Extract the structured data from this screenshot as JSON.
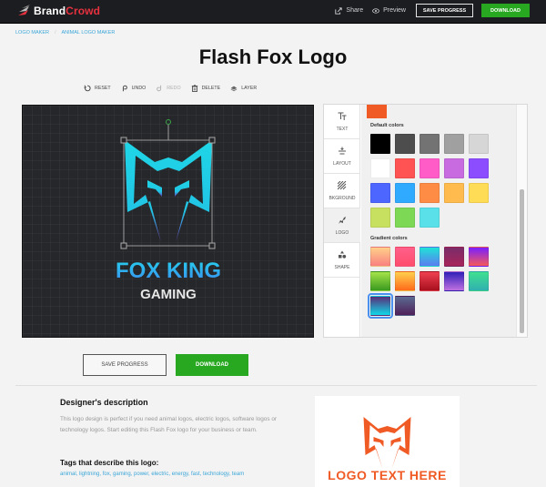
{
  "header": {
    "brand_part1": "Brand",
    "brand_part2": "Crowd",
    "share_label": "Share",
    "preview_label": "Preview",
    "save_progress_label": "SAVE PROGRESS",
    "download_label": "DOWNLOAD"
  },
  "breadcrumb": {
    "items": [
      "LOGO MAKER",
      "ANIMAL LOGO MAKER"
    ],
    "separator": "/"
  },
  "page_title": "Flash Fox Logo",
  "toolbar": {
    "reset": "RESET",
    "undo": "UNDO",
    "redo": "REDO",
    "delete": "DELETE",
    "layer": "LAYER"
  },
  "canvas": {
    "logo_title": "FOX KING",
    "logo_subtitle": "GAMING"
  },
  "editor_tabs": [
    {
      "label": "TEXT",
      "icon": "text-icon"
    },
    {
      "label": "LAYOUT",
      "icon": "layout-icon"
    },
    {
      "label": "BKGROUND",
      "icon": "background-icon"
    },
    {
      "label": "LOGO",
      "icon": "logo-icon",
      "active": true
    },
    {
      "label": "SHAPE",
      "icon": "shape-icon"
    }
  ],
  "color_panel": {
    "current_color": "#f05a24",
    "default_colors_label": "Default colors",
    "default_colors": [
      "#000000",
      "#4d4d4d",
      "#737373",
      "#a0a0a0",
      "#d6d6d6",
      "#ffffff",
      "#ff5252",
      "#ff5cc8",
      "#c86be0",
      "#8c4dff",
      "#4d66ff",
      "#30aaff",
      "#ff8c45",
      "#ffbb4d",
      "#ffdc55",
      "#c8e060",
      "#7dd855",
      "#5ae0e8"
    ],
    "gradient_colors_label": "Gradient colors",
    "gradient_colors": [
      [
        "#ffd08a",
        "#f98080"
      ],
      [
        "#ff5f8a",
        "#ff4d6d"
      ],
      [
        "#20e3d8",
        "#5b7cf0"
      ],
      [
        "#7a2d6a",
        "#a8245a"
      ],
      [
        "#7b1fff",
        "#f55a5a"
      ],
      [
        "#a6e34a",
        "#3a9a1e"
      ],
      [
        "#ffd04d",
        "#ff6a1a"
      ],
      [
        "#ef4050",
        "#a8101e"
      ],
      [
        "#3020b8",
        "#c070e0"
      ],
      [
        "#40e090",
        "#30b0b0"
      ],
      [
        "#5a2d7a",
        "#10d8e8"
      ],
      [
        "#5a6a90",
        "#50205a"
      ]
    ],
    "selected_gradient_index": 10
  },
  "actions": {
    "save_progress_label": "SAVE PROGRESS",
    "download_label": "DOWNLOAD"
  },
  "description": {
    "heading": "Designer's description",
    "body": "This logo design is perfect if you need animal logos, electric logos, software logos or technology logos. Start editing this Flash Fox logo for your business or team.",
    "tags_heading": "Tags that describe this logo:",
    "tags_line": "animal, lightning, fox, gaming, power, electric, energy, fast, technology, team"
  },
  "preview_card": {
    "text": "LOGO TEXT HERE",
    "color": "#f05a24"
  }
}
